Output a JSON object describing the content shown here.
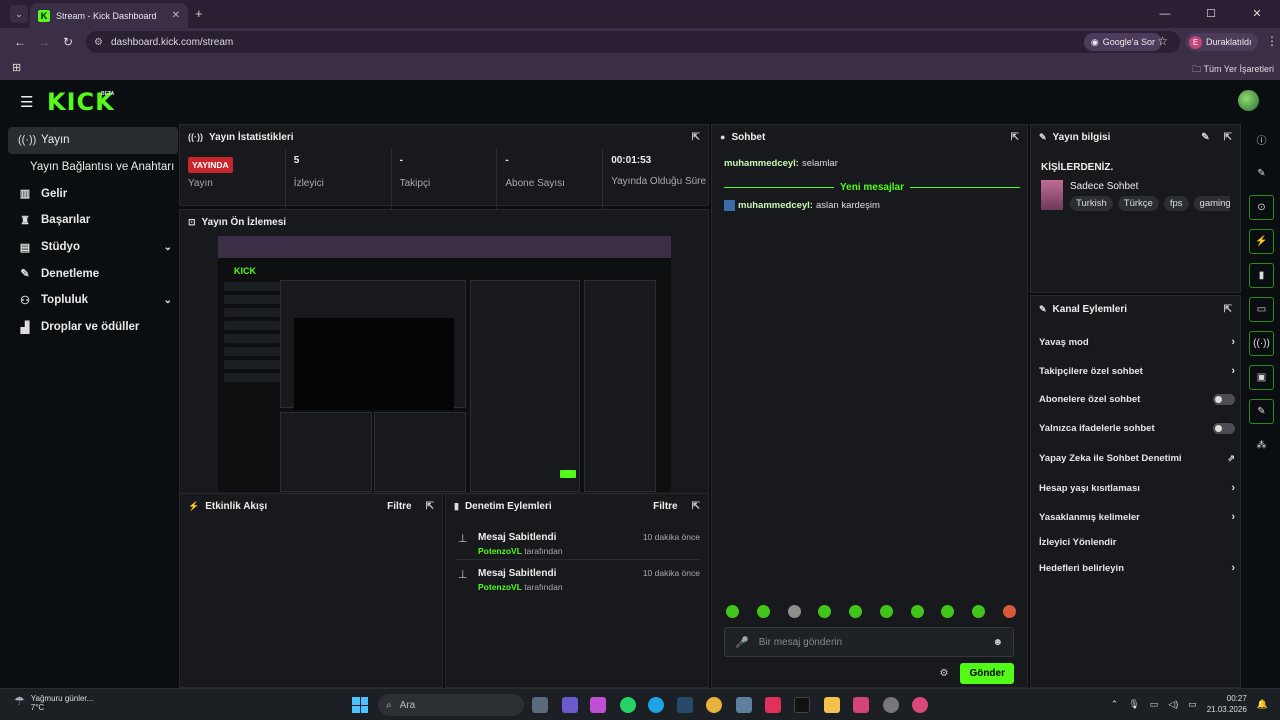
{
  "browser": {
    "tab_title": "Stream - Kick Dashboard",
    "tab_favicon": "K",
    "url": "dashboard.kick.com/stream",
    "ask_button": "Google'a Sor",
    "profile_initial": "E",
    "profile_status": "Duraklatıldı",
    "bookmarks_label": "Tüm Yer İşaretleri"
  },
  "header": {
    "logo": "KICK",
    "beta": "BETA"
  },
  "sidebar": {
    "items": [
      {
        "label": "Yayın",
        "icon": "broadcast-icon"
      },
      {
        "label": "Yayın Bağlantısı ve Anahtarı"
      },
      {
        "label": "Gelir",
        "icon": "bank-icon"
      },
      {
        "label": "Başarılar",
        "icon": "trophy-icon"
      },
      {
        "label": "Stüdyo",
        "icon": "studio-icon"
      },
      {
        "label": "Denetleme",
        "icon": "wrench-icon"
      },
      {
        "label": "Topluluk",
        "icon": "community-icon"
      },
      {
        "label": "Droplar ve ödüller",
        "icon": "drops-icon"
      }
    ]
  },
  "stats": {
    "title": "Yayın İstatistikleri",
    "live_badge": "YAYINDA",
    "items": [
      {
        "value": "",
        "label": "Yayın"
      },
      {
        "value": "5",
        "label": "İzleyici"
      },
      {
        "value": "-",
        "label": "Takipçi"
      },
      {
        "value": "-",
        "label": "Abone Sayısı"
      },
      {
        "value": "00:01:53",
        "label": "Yayında Olduğu Süre"
      }
    ]
  },
  "preview": {
    "title": "Yayın Ön İzlemesi"
  },
  "activity": {
    "title": "Etkinlik Akışı",
    "filter": "Filtre"
  },
  "moderation": {
    "title": "Denetim Eylemleri",
    "filter": "Filtre",
    "entries": [
      {
        "action": "Mesaj Sabitlendi",
        "user": "PotenzoVL",
        "by": "tarafından",
        "time": "10 dakika önce"
      },
      {
        "action": "Mesaj Sabitlendi",
        "user": "PotenzoVL",
        "by": "tarafından",
        "time": "10 dakika önce"
      }
    ]
  },
  "chat": {
    "title": "Sohbet",
    "messages": [
      {
        "user": "muhammedceyl:",
        "text": "selamlar"
      },
      {
        "user": "muhammedceyl:",
        "text": "aslan kardeşim"
      }
    ],
    "new_messages": "Yeni mesajlar",
    "input_placeholder": "Bir mesaj gönderin",
    "send": "Gönder"
  },
  "stream_info": {
    "title": "Yayın bilgisi",
    "stream_title": "KİŞİLERDENİZ.",
    "category": "Sadece Sohbet",
    "tags": [
      "Turkish",
      "Türkçe",
      "fps",
      "gaming"
    ]
  },
  "channel_actions": {
    "title": "Kanal Eylemleri",
    "items": [
      {
        "label": "Yavaş mod",
        "control": "arrow"
      },
      {
        "label": "Takipçilere özel sohbet",
        "control": "arrow"
      },
      {
        "label": "Abonelere özel sohbet",
        "control": "toggle"
      },
      {
        "label": "Yalnızca ifadelerle sohbet",
        "control": "toggle"
      },
      {
        "label": "Yapay Zeka ile Sohbet Denetimi",
        "control": "external"
      },
      {
        "label": "Hesap yaşı kısıtlaması",
        "control": "arrow"
      },
      {
        "label": "Yasaklanmış kelimeler",
        "control": "arrow"
      },
      {
        "label": "İzleyici Yönlendir",
        "control": "none"
      },
      {
        "label": "Hedefleri belirleyin",
        "control": "arrow"
      }
    ]
  },
  "taskbar": {
    "weather_text": "Yağmuru günler...",
    "temperature": "7°C",
    "search": "Ara",
    "time": "00:27",
    "date": "21.03.2026"
  },
  "colors": {
    "accent": "#53fc18",
    "live": "#c8262b",
    "panel": "#17191c"
  }
}
